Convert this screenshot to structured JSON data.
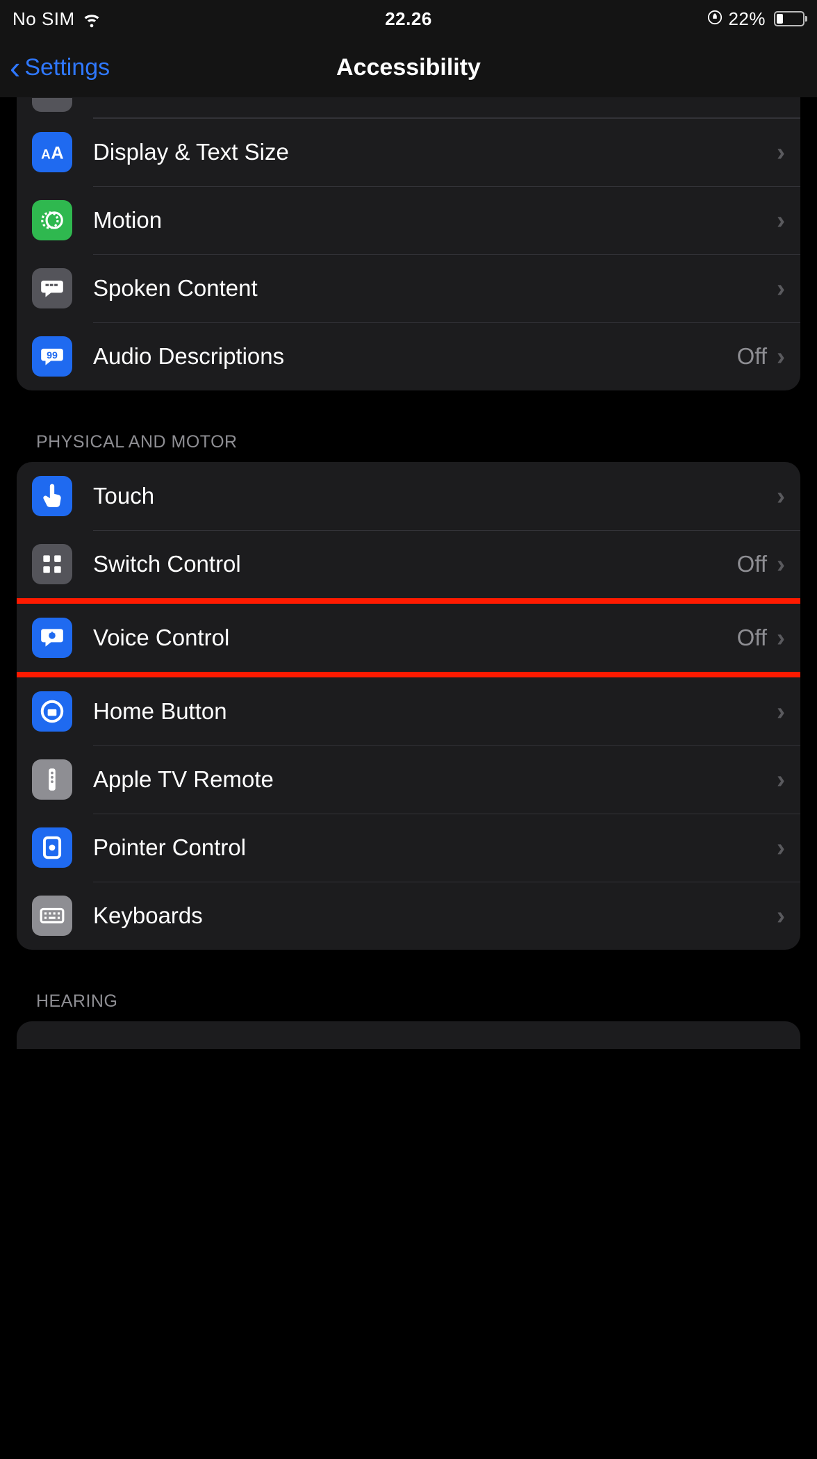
{
  "status": {
    "carrier": "No SIM",
    "time": "22.26",
    "battery_percent": "22%"
  },
  "nav": {
    "back_label": "Settings",
    "title": "Accessibility"
  },
  "group1": {
    "items": [
      {
        "label": "Display & Text Size",
        "value": ""
      },
      {
        "label": "Motion",
        "value": ""
      },
      {
        "label": "Spoken Content",
        "value": ""
      },
      {
        "label": "Audio Descriptions",
        "value": "Off"
      }
    ]
  },
  "section_physical": "PHYSICAL AND MOTOR",
  "group2": {
    "items": [
      {
        "label": "Touch",
        "value": ""
      },
      {
        "label": "Switch Control",
        "value": "Off"
      },
      {
        "label": "Voice Control",
        "value": "Off"
      },
      {
        "label": "Home Button",
        "value": ""
      },
      {
        "label": "Apple TV Remote",
        "value": ""
      },
      {
        "label": "Pointer Control",
        "value": ""
      },
      {
        "label": "Keyboards",
        "value": ""
      }
    ]
  },
  "section_hearing": "HEARING"
}
